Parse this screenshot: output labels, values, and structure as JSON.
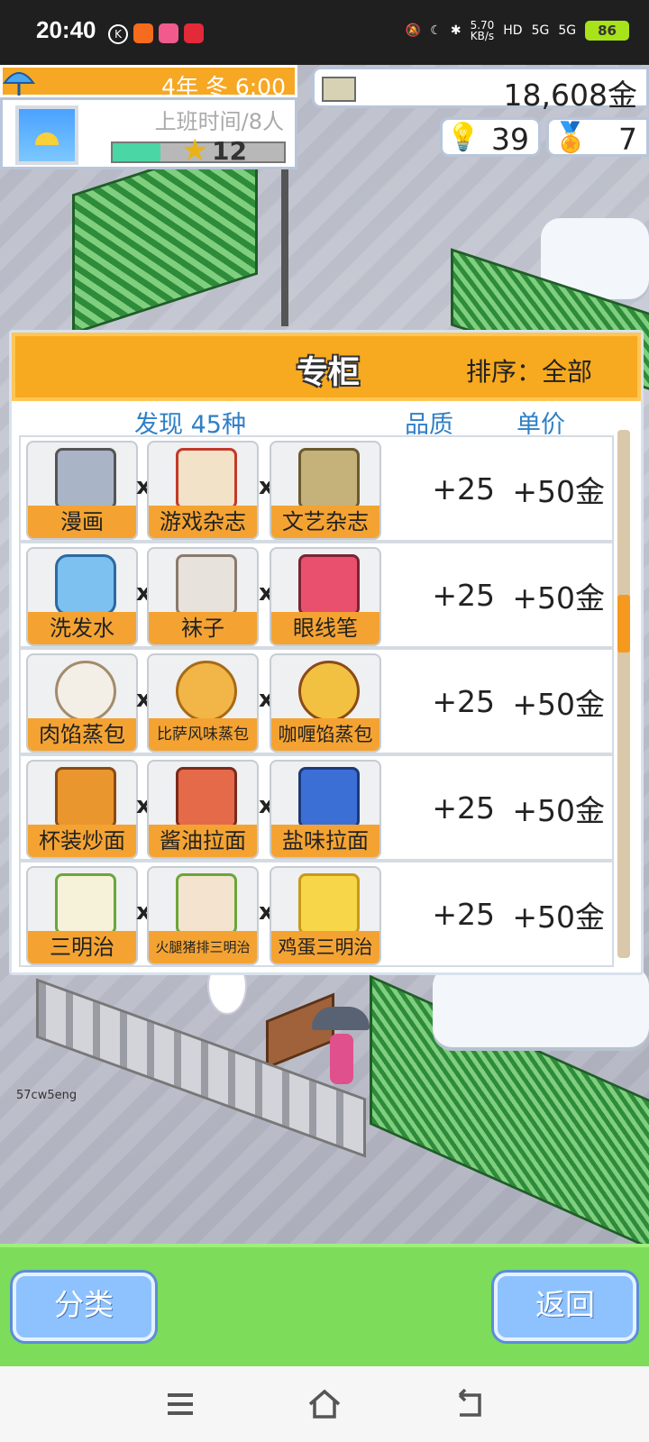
{
  "status_bar": {
    "time": "20:40",
    "k_badge": "K",
    "speed": "5.70",
    "speed_unit": "KB/s",
    "hd": "HD",
    "sig1": "5G",
    "sig2": "5G",
    "battery": "86"
  },
  "hud": {
    "date": "4年 冬 6:00",
    "shift": "上班时间/8人",
    "level": "12",
    "money": "18,608金",
    "ideas": "39",
    "medals": "7"
  },
  "panel": {
    "title": "专柜",
    "sort": "排序：全部",
    "col_found": "发现 45种",
    "col_quality": "品质",
    "col_price": "单价",
    "times": "x"
  },
  "rows": [
    {
      "items": [
        "漫画",
        "游戏杂志",
        "文艺杂志"
      ],
      "quality": "+25",
      "price": "+50金"
    },
    {
      "items": [
        "洗发水",
        "袜子",
        "眼线笔"
      ],
      "quality": "+25",
      "price": "+50金"
    },
    {
      "items": [
        "肉馅蒸包",
        "比萨风味蒸包",
        "咖喱馅蒸包"
      ],
      "quality": "+25",
      "price": "+50金"
    },
    {
      "items": [
        "杯装炒面",
        "酱油拉面",
        "盐味拉面"
      ],
      "quality": "+25",
      "price": "+50金"
    },
    {
      "items": [
        "三明治",
        "火腿猪排三明治",
        "鸡蛋三明治"
      ],
      "quality": "+25",
      "price": "+50金"
    }
  ],
  "scroll_position": 0.35,
  "hud_progress": 0.28,
  "watermark": "57cw5eng",
  "bottom": {
    "category": "分类",
    "back": "返回"
  },
  "colors": {
    "accent": "#f7a91f",
    "button": "#8dc2ff",
    "bar_green": "#7ddc5a",
    "header_blue": "#2f7fc7"
  },
  "icons": [
    "umbrella-icon",
    "weather-icon",
    "money-icon",
    "lightbulb-icon",
    "medal-icon",
    "menu-icon",
    "home-icon",
    "back-icon"
  ]
}
